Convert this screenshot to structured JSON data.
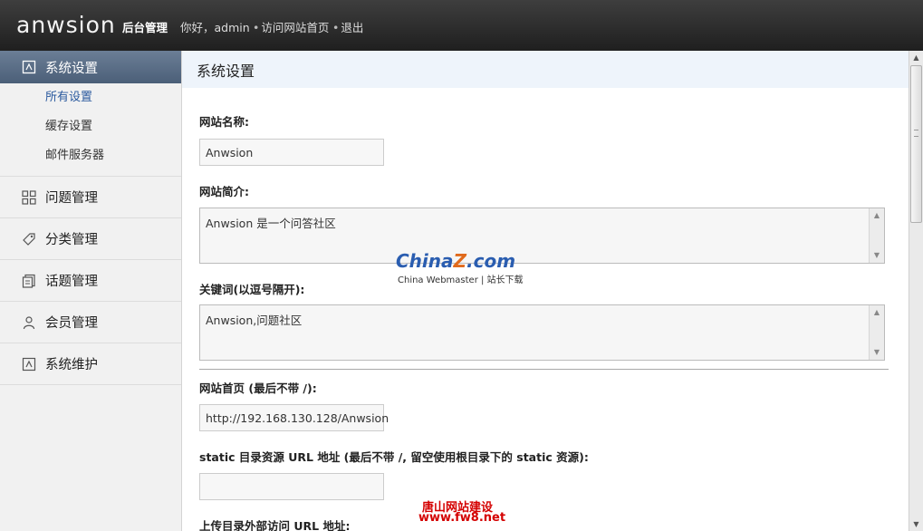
{
  "topbar": {
    "logo": "anwsion",
    "subtitle": "后台管理",
    "greeting": "你好，admin",
    "links": [
      "访问网站首页",
      "退出"
    ]
  },
  "sidebar": {
    "section": {
      "label": "系统设置",
      "icon": "settings-icon"
    },
    "sub_items": [
      "所有设置",
      "缓存设置",
      "邮件服务器"
    ],
    "active_sub": "所有设置",
    "nav": [
      {
        "label": "问题管理",
        "icon": "grid-icon"
      },
      {
        "label": "分类管理",
        "icon": "tag-icon"
      },
      {
        "label": "话题管理",
        "icon": "documents-icon"
      },
      {
        "label": "会员管理",
        "icon": "user-icon"
      },
      {
        "label": "系统维护",
        "icon": "maintenance-icon"
      }
    ]
  },
  "main": {
    "title": "系统设置",
    "fields": {
      "site_name_label": "网站名称:",
      "site_name_value": "Anwsion",
      "site_desc_label": "网站简介:",
      "site_desc_value": "Anwsion 是一个问答社区",
      "keywords_label": "关键词(以逗号隔开):",
      "keywords_value": "Anwsion,问题社区",
      "home_label": "网站首页 (最后不带 /):",
      "home_value": "http://192.168.130.128/Anwsion",
      "static_label": "static 目录资源 URL 地址 (最后不带 /, 留空使用根目录下的 static 资源):",
      "static_value": "",
      "upload_label": "上传目录外部访问 URL 地址:"
    }
  },
  "watermarks": {
    "china_a": "China",
    "china_b": "Z",
    "china_c": ".com",
    "china_sub": "China Webmaster | 站长下载",
    "fw8_line1": "唐山网站建设",
    "fw8_line2": "www.fw8.net"
  },
  "colors": {
    "accent": "#4b5f78",
    "title_bg": "#eef4fb",
    "topbar": "#2a2a2a"
  }
}
